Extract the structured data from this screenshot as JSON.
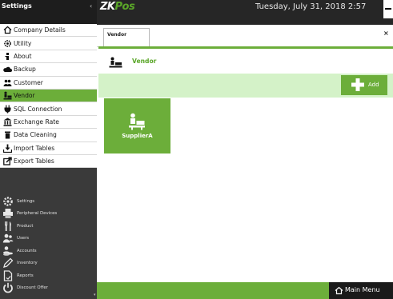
{
  "sidebar": {
    "title": "Settings",
    "chevron": "‹",
    "settings_items": [
      {
        "label": "Company Details",
        "icon": "home-icon"
      },
      {
        "label": "Utility",
        "icon": "gear-icon"
      },
      {
        "label": "About",
        "icon": "info-icon"
      },
      {
        "label": "Backup",
        "icon": "cloud-icon"
      },
      {
        "label": "Customer",
        "icon": "customers-icon"
      },
      {
        "label": "Vendor",
        "icon": "vendor-icon",
        "active": true
      },
      {
        "label": "SQL Connection",
        "icon": "plug-icon"
      },
      {
        "label": "Exchange Rate",
        "icon": "bank-icon"
      },
      {
        "label": "Data Cleaning",
        "icon": "trash-icon"
      },
      {
        "label": "Import Tables",
        "icon": "import-icon"
      },
      {
        "label": "Export Tables",
        "icon": "export-icon"
      }
    ],
    "nav_items": [
      {
        "label": "Settings",
        "icon": "settings-gear-icon"
      },
      {
        "label": "Peripheral Devices",
        "icon": "printer-icon"
      },
      {
        "label": "Product",
        "icon": "cutlery-icon"
      },
      {
        "label": "Users",
        "icon": "users-icon"
      },
      {
        "label": "Accounts",
        "icon": "coins-icon"
      },
      {
        "label": "Inventory",
        "icon": "pencil-icon"
      },
      {
        "label": "Reports",
        "icon": "report-icon"
      },
      {
        "label": "Discount Offer",
        "icon": "power-icon"
      }
    ],
    "scroll_arrow": "▾"
  },
  "topbar": {
    "logo_zk": "ZK",
    "logo_pos": "Pos",
    "datetime": "Tuesday, July 31, 2018 2:57"
  },
  "tab": {
    "label": "Vendor",
    "close": "×"
  },
  "page": {
    "title": "Vendor",
    "add_label": "Add"
  },
  "vendors": [
    {
      "name": "SupplierA"
    }
  ],
  "footer": {
    "main_menu_label": "Main Menu"
  },
  "colors": {
    "accent_green": "#6cae3a",
    "light_green": "#d4f2c8",
    "sidebar_dark": "#3a3a3a",
    "topbar_dark": "#262626"
  }
}
